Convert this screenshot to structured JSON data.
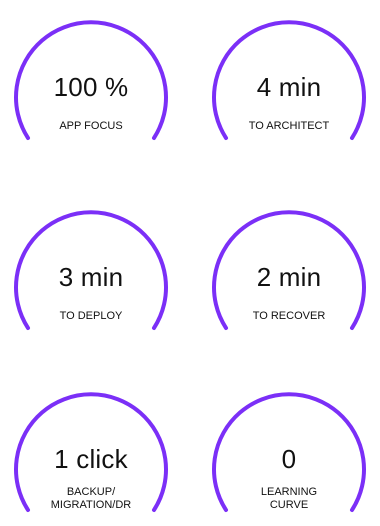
{
  "accent_color": "#7b2ff7",
  "gauges": [
    {
      "value": "100 %",
      "label": "APP FOCUS"
    },
    {
      "value": "4 min",
      "label": "TO ARCHITECT"
    },
    {
      "value": "3 min",
      "label": "TO DEPLOY"
    },
    {
      "value": "2 min",
      "label": "TO RECOVER"
    },
    {
      "value": "1 click",
      "label_line1": "BACKUP/",
      "label_line2": "MIGRATION/DR"
    },
    {
      "value": "0",
      "label_line1": "LEARNING",
      "label_line2": "CURVE"
    }
  ]
}
